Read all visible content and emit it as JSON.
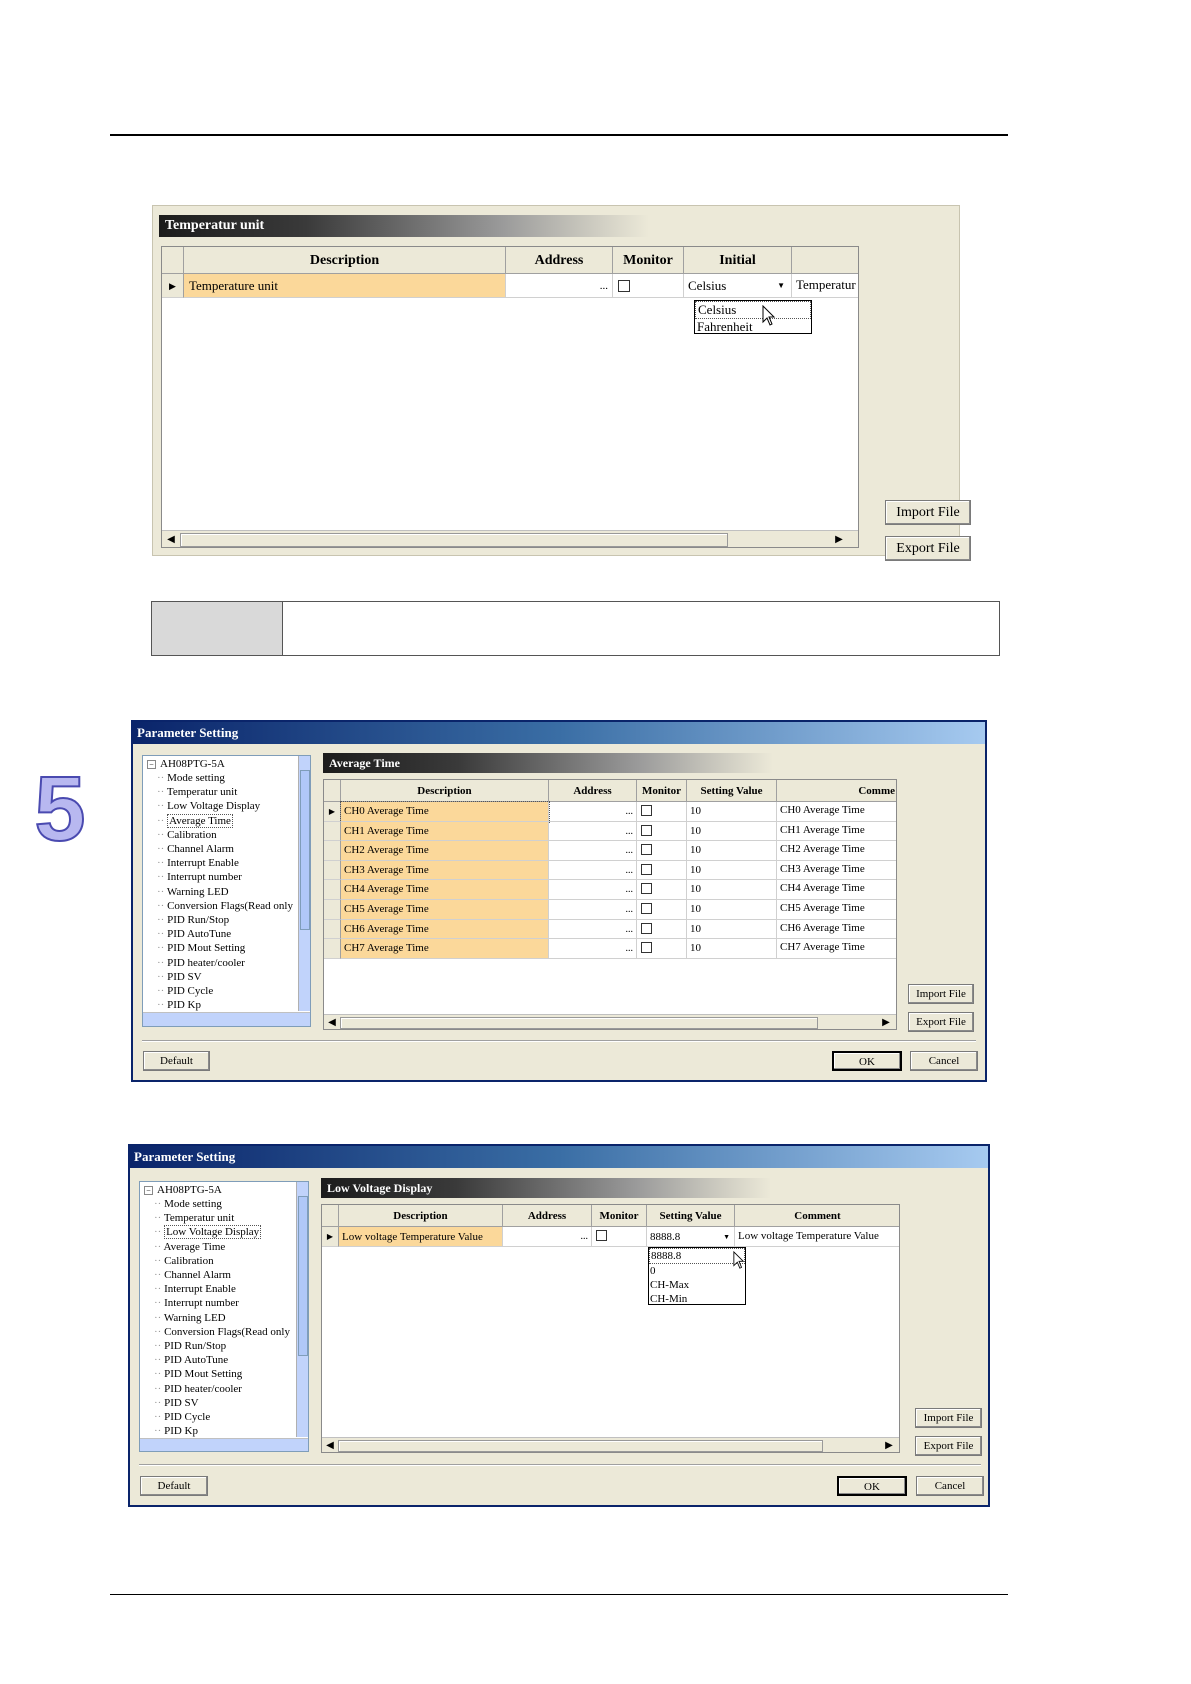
{
  "page": {
    "chapter_number": "5"
  },
  "temp_unit_panel": {
    "title": "Temperatur unit",
    "columns": [
      "Description",
      "Address",
      "Monitor",
      "Initial"
    ],
    "row": {
      "description": "Temperature unit",
      "address_button": "...",
      "initial": "Celsius",
      "comment_partial": "Temperatur"
    },
    "dropdown": [
      "Celsius",
      "Fahrenheit"
    ],
    "buttons": {
      "import": "Import File",
      "export": "Export File"
    }
  },
  "dialog1": {
    "title": "Parameter Setting",
    "tree": {
      "root": "AH08PTG-5A",
      "items": [
        "Mode setting",
        "Temperatur unit",
        "Low Voltage Display",
        "Average Time",
        "Calibration",
        "Channel Alarm",
        "Interrupt Enable",
        "Interrupt number",
        "Warning LED",
        "Conversion Flags(Read only",
        "PID Run/Stop",
        "PID AutoTune",
        "PID Mout Setting",
        "PID heater/cooler",
        "PID SV",
        "PID Cycle",
        "PID Kp"
      ]
    },
    "panel_title": "Average Time",
    "columns": [
      "Description",
      "Address",
      "Monitor",
      "Setting Value",
      "Comme"
    ],
    "rows": [
      {
        "description": "CH0 Average Time",
        "value": "10",
        "comment": "CH0 Average Time"
      },
      {
        "description": "CH1 Average Time",
        "value": "10",
        "comment": "CH1 Average Time"
      },
      {
        "description": "CH2 Average Time",
        "value": "10",
        "comment": "CH2 Average Time"
      },
      {
        "description": "CH3 Average Time",
        "value": "10",
        "comment": "CH3 Average Time"
      },
      {
        "description": "CH4 Average Time",
        "value": "10",
        "comment": "CH4 Average Time"
      },
      {
        "description": "CH5 Average Time",
        "value": "10",
        "comment": "CH5 Average Time"
      },
      {
        "description": "CH6 Average Time",
        "value": "10",
        "comment": "CH6 Average Time"
      },
      {
        "description": "CH7 Average Time",
        "value": "10",
        "comment": "CH7 Average Time"
      }
    ],
    "buttons": {
      "import": "Import File",
      "export": "Export File",
      "default": "Default",
      "ok": "OK",
      "cancel": "Cancel"
    }
  },
  "dialog2": {
    "title": "Parameter Setting",
    "tree": {
      "root": "AH08PTG-5A",
      "items": [
        "Mode setting",
        "Temperatur unit",
        "Low Voltage Display",
        "Average Time",
        "Calibration",
        "Channel Alarm",
        "Interrupt Enable",
        "Interrupt number",
        "Warning LED",
        "Conversion Flags(Read only",
        "PID Run/Stop",
        "PID AutoTune",
        "PID Mout Setting",
        "PID heater/cooler",
        "PID SV",
        "PID Cycle",
        "PID Kp"
      ]
    },
    "panel_title": "Low Voltage Display",
    "columns": [
      "Description",
      "Address",
      "Monitor",
      "Setting Value",
      "Comment"
    ],
    "row": {
      "description": "Low voltage Temperature  Value",
      "value": "8888.8",
      "comment": "Low voltage Temperature  Value"
    },
    "dropdown": [
      "8888.8",
      "0",
      "CH-Max",
      "CH-Min"
    ],
    "buttons": {
      "import": "Import File",
      "export": "Export File",
      "default": "Default",
      "ok": "OK",
      "cancel": "Cancel"
    }
  }
}
